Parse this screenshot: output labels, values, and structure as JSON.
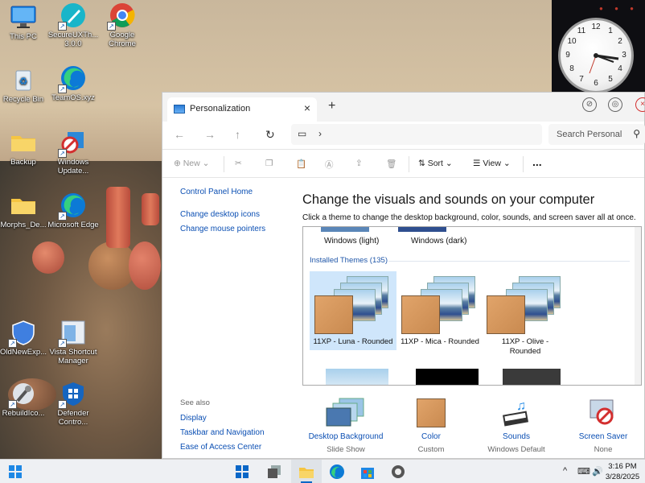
{
  "desktop": {
    "icons": [
      {
        "label": "This PC"
      },
      {
        "label": "SecureUXTh... 3.0.0"
      },
      {
        "label": "Google Chrome"
      },
      {
        "label": "Recycle Bin"
      },
      {
        "label": "TeamOS.xyz"
      },
      {
        "label": "Backup"
      },
      {
        "label": "Windows Update..."
      },
      {
        "label": "Morphs_De..."
      },
      {
        "label": "Microsoft Edge"
      },
      {
        "label": "OldNewExp..."
      },
      {
        "label": "Vista Shortcut Manager"
      },
      {
        "label": "RebuildIco..."
      },
      {
        "label": "Defender Contro..."
      }
    ]
  },
  "clock": {
    "numbers": [
      "12",
      "1",
      "2",
      "3",
      "4",
      "5",
      "6",
      "7",
      "8",
      "9",
      "10",
      "11"
    ],
    "time": "3:16"
  },
  "window": {
    "tab_title": "Personalization",
    "search_placeholder": "Search Personal",
    "commands": {
      "new": "New",
      "sort": "Sort",
      "view": "View",
      "more": "..."
    },
    "left_links": [
      "Control Panel Home",
      "Change desktop icons",
      "Change mouse pointers"
    ],
    "see_also_heading": "See also",
    "see_also_links": [
      "Display",
      "Taskbar and Navigation",
      "Ease of Access Center"
    ],
    "heading": "Change the visuals and sounds on your computer",
    "subheading": "Click a theme to change the desktop background, color, sounds, and screen saver all at once.",
    "default_themes": [
      "Windows (light)",
      "Windows (dark)"
    ],
    "installed_heading": "Installed Themes (135)",
    "installed_themes": [
      {
        "name": "11XP - Luna - Rounded",
        "selected": true
      },
      {
        "name": "11XP - Mica - Rounded",
        "selected": false
      },
      {
        "name": "11XP - Olive - Rounded",
        "selected": false
      }
    ],
    "bottom": [
      {
        "label": "Desktop Background",
        "value": "Slide Show"
      },
      {
        "label": "Color",
        "value": "Custom"
      },
      {
        "label": "Sounds",
        "value": "Windows Default"
      },
      {
        "label": "Screen Saver",
        "value": "None"
      }
    ]
  },
  "taskbar": {
    "time": "3:16 PM",
    "date": "3/28/2025"
  }
}
